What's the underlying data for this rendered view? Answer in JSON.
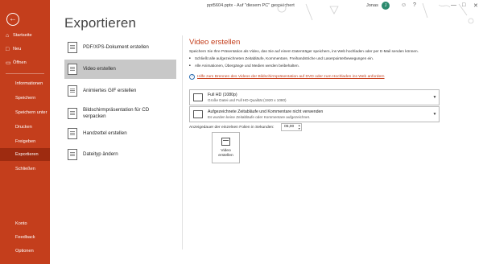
{
  "titlebar": {
    "document_title": "ppt5604.pptx  -  Auf \"diesem PC\" gespeichert",
    "user_name": "Jonas",
    "user_initial": "J"
  },
  "sidebar": {
    "top_items": [
      {
        "label": "Startseite",
        "icon": "home-icon"
      },
      {
        "label": "Neu",
        "icon": "new-document-icon"
      },
      {
        "label": "Öffnen",
        "icon": "open-folder-icon"
      }
    ],
    "items": [
      {
        "label": "Informationen"
      },
      {
        "label": "Speichern"
      },
      {
        "label": "Speichern unter"
      },
      {
        "label": "Drucken"
      },
      {
        "label": "Freigeben"
      },
      {
        "label": "Exportieren",
        "active": true
      },
      {
        "label": "Schließen"
      }
    ],
    "bottom_items": [
      {
        "label": "Konto"
      },
      {
        "label": "Feedback"
      },
      {
        "label": "Optionen"
      }
    ],
    "accent_color": "#c43e1c",
    "active_color": "#9e2b10"
  },
  "page": {
    "title": "Exportieren"
  },
  "export_options": [
    {
      "label": "PDF/XPS-Dokument erstellen",
      "icon": "pdf-icon"
    },
    {
      "label": "Video erstellen",
      "icon": "video-icon",
      "selected": true
    },
    {
      "label": "Animiertes GIF erstellen",
      "icon": "gif-icon"
    },
    {
      "label_line1": "Bildschirmpräsentation für CD",
      "label_line2": "verpacken",
      "icon": "cd-package-icon"
    },
    {
      "label": "Handzettel erstellen",
      "icon": "handout-icon"
    },
    {
      "label": "Dateityp ändern",
      "icon": "change-filetype-icon"
    }
  ],
  "panel": {
    "title": "Video erstellen",
    "description": "Speichern Sie Ihre Präsentation als Video, das Sie auf einem Datenträger speichern, ins Web hochladen oder per E-Mail senden können.",
    "bullets": [
      "Schließt alle aufgezeichneten Zeitabläufe, Kommentare, Freihandstriche und Laserpointerbewegungen ein.",
      "Alle Animationen, Übergänge und Medien werden beibehalten."
    ],
    "help_link": "Hilfe zum Brennen des Videos der Bildschirmpräsentation auf DVD oder zum Hochladen ins Web anfordern",
    "quality_dropdown": {
      "main": "Full HD (1080p)",
      "sub": "Große Datei und Full HD-Qualität (1920 x 1080)"
    },
    "timing_dropdown": {
      "main": "Aufgezeichnete Zeitabläufe und Kommentare nicht verwenden",
      "sub": "Es wurden keine Zeitabläufe oder Kommentare aufgezeichnet."
    },
    "duration_label": "Anzeigedauer der einzelnen Folien in Sekunden:",
    "duration_value": "05,00",
    "create_button_line1": "Video",
    "create_button_line2": "erstellen"
  }
}
